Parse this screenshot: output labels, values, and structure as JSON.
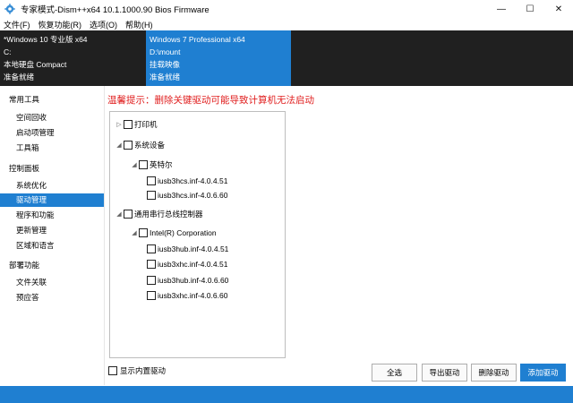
{
  "window": {
    "title": "专家模式-Dism++x64 10.1.1000.90 Bios Firmware",
    "minimize_glyph": "—",
    "maximize_glyph": "☐",
    "close_glyph": "✕"
  },
  "menu": [
    "文件(F)",
    "恢复功能(R)",
    "选项(O)",
    "帮助(H)"
  ],
  "sessions": [
    {
      "name": "*Windows 10 专业版 x64",
      "path": "C:",
      "type": "本地硬盘 Compact",
      "status": "准备就绪"
    },
    {
      "name": "Windows 7 Professional x64",
      "path": "D:\\mount",
      "type": "挂载映像",
      "status": "准备就绪"
    }
  ],
  "sidebar": {
    "groups": [
      {
        "title": "常用工具",
        "items": [
          "空间回收",
          "启动项管理",
          "工具箱"
        ]
      },
      {
        "title": "控制面板",
        "items": [
          "系统优化",
          "驱动管理",
          "程序和功能",
          "更新管理",
          "区域和语言"
        ]
      },
      {
        "title": "部署功能",
        "items": [
          "文件关联",
          "预应答"
        ]
      }
    ],
    "active": "驱动管理"
  },
  "warning": "温馨提示：删除关键驱动可能导致计算机无法启动",
  "tree": [
    {
      "label": "打印机",
      "arrow": "▷"
    },
    {
      "label": "系统设备",
      "arrow": "◢"
    },
    {
      "label": "英特尔",
      "arrow": "◢"
    },
    {
      "label": "iusb3hcs.inf-4.0.4.51",
      "arrow": ""
    },
    {
      "label": "iusb3hcs.inf-4.0.6.60",
      "arrow": ""
    },
    {
      "label": "通用串行总线控制器",
      "arrow": "◢"
    },
    {
      "label": "Intel(R) Corporation",
      "arrow": "◢"
    },
    {
      "label": "iusb3hub.inf-4.0.4.51",
      "arrow": ""
    },
    {
      "label": "iusb3xhc.inf-4.0.4.51",
      "arrow": ""
    },
    {
      "label": "iusb3hub.inf-4.0.6.60",
      "arrow": ""
    },
    {
      "label": "iusb3xhc.inf-4.0.6.60",
      "arrow": ""
    }
  ],
  "show_builtin_label": "显示内置驱动",
  "buttons": {
    "select_all": "全选",
    "export": "导出驱动",
    "delete": "删除驱动",
    "add": "添加驱动"
  },
  "colors": {
    "accent": "#1f7fd1",
    "warning": "#e01e1e",
    "session_bg": "#202020"
  }
}
